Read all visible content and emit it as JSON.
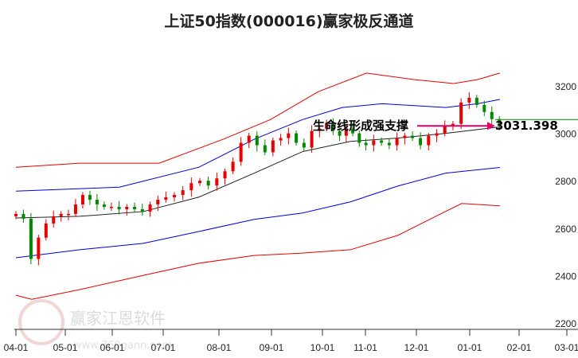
{
  "chart_data": {
    "type": "candlestick",
    "title": "上证50指数(000016)赢家极反通道",
    "xlabel": "",
    "ylabel": "",
    "ylim": [
      2200,
      3280
    ],
    "yticks": [
      2200,
      2400,
      2600,
      2800,
      3000,
      3200
    ],
    "xticks": [
      "04-01",
      "05-01",
      "06-01",
      "07-01",
      "08-01",
      "09-01",
      "10-01",
      "11-01",
      "12-01",
      "01-01",
      "02-01",
      "03-01"
    ],
    "x_unit": "months since 04-01",
    "closes_start": 0,
    "closes_end": 9.6,
    "closes": [
      2660,
      2640,
      2470,
      2560,
      2620,
      2650,
      2660,
      2660,
      2700,
      2740,
      2720,
      2700,
      2690,
      2690,
      2680,
      2690,
      2680,
      2670,
      2700,
      2720,
      2730,
      2740,
      2760,
      2790,
      2800,
      2780,
      2810,
      2840,
      2880,
      2960,
      2990,
      2950,
      2920,
      2970,
      2980,
      3000,
      2960,
      2940,
      3010,
      3020,
      3040,
      3010,
      2990,
      3020,
      3000,
      2960,
      2950,
      2970,
      2960,
      2950,
      2980,
      2990,
      2980,
      2950,
      2990,
      3000,
      3030,
      3040,
      3130,
      3150,
      3120,
      3090,
      3060,
      3040
    ],
    "bands": [
      {
        "name": "upper-red",
        "color": "#e60000",
        "points": [
          [
            0,
            2857
          ],
          [
            1.31,
            2874
          ],
          [
            2.92,
            2874
          ],
          [
            4.08,
            2975
          ],
          [
            4.98,
            3058
          ],
          [
            5.92,
            3176
          ],
          [
            7.02,
            3254
          ],
          [
            7.95,
            3227
          ],
          [
            8.7,
            3210
          ],
          [
            9.16,
            3227
          ],
          [
            9.61,
            3254
          ]
        ]
      },
      {
        "name": "upper-blue",
        "color": "#0000e0",
        "points": [
          [
            0,
            2756
          ],
          [
            2.14,
            2773
          ],
          [
            3.64,
            2857
          ],
          [
            4.67,
            2975
          ],
          [
            5.61,
            3058
          ],
          [
            6.46,
            3109
          ],
          [
            7.33,
            3125
          ],
          [
            8.55,
            3109
          ],
          [
            9.16,
            3125
          ],
          [
            9.61,
            3143
          ]
        ]
      },
      {
        "name": "lifeline",
        "color": "#222222",
        "points": [
          [
            0,
            2643
          ],
          [
            1.31,
            2650
          ],
          [
            2.61,
            2670
          ],
          [
            3.64,
            2731
          ],
          [
            4.67,
            2832
          ],
          [
            5.61,
            2923
          ],
          [
            6.65,
            2966
          ],
          [
            7.64,
            2980
          ],
          [
            8.55,
            3000
          ],
          [
            9.61,
            3027
          ]
        ]
      },
      {
        "name": "lower-blue",
        "color": "#0000e0",
        "points": [
          [
            0,
            2475
          ],
          [
            1.31,
            2509
          ],
          [
            2.61,
            2536
          ],
          [
            3.64,
            2586
          ],
          [
            4.67,
            2637
          ],
          [
            5.61,
            2664
          ],
          [
            6.65,
            2711
          ],
          [
            7.64,
            2778
          ],
          [
            8.55,
            2832
          ],
          [
            9.61,
            2856
          ]
        ]
      },
      {
        "name": "lower-red",
        "color": "#e60000",
        "points": [
          [
            0,
            2317
          ],
          [
            0.32,
            2300
          ],
          [
            1.31,
            2341
          ],
          [
            2.61,
            2401
          ],
          [
            3.64,
            2452
          ],
          [
            4.67,
            2485
          ],
          [
            5.61,
            2495
          ],
          [
            6.65,
            2509
          ],
          [
            7.64,
            2570
          ],
          [
            8.4,
            2654
          ],
          [
            8.85,
            2704
          ],
          [
            9.61,
            2694
          ]
        ]
      }
    ],
    "annotation": "生命线形成强支撑",
    "last_value": "3031.398",
    "last_value_num": 3031.398,
    "colors": {
      "up": "#e60000",
      "down": "#008800",
      "arrow": "#e0006a",
      "last_line": "#008800"
    }
  },
  "watermark": {
    "brand": "赢家江恩软件",
    "url": "www.360gann.com",
    "seal": "江赢恩家"
  }
}
